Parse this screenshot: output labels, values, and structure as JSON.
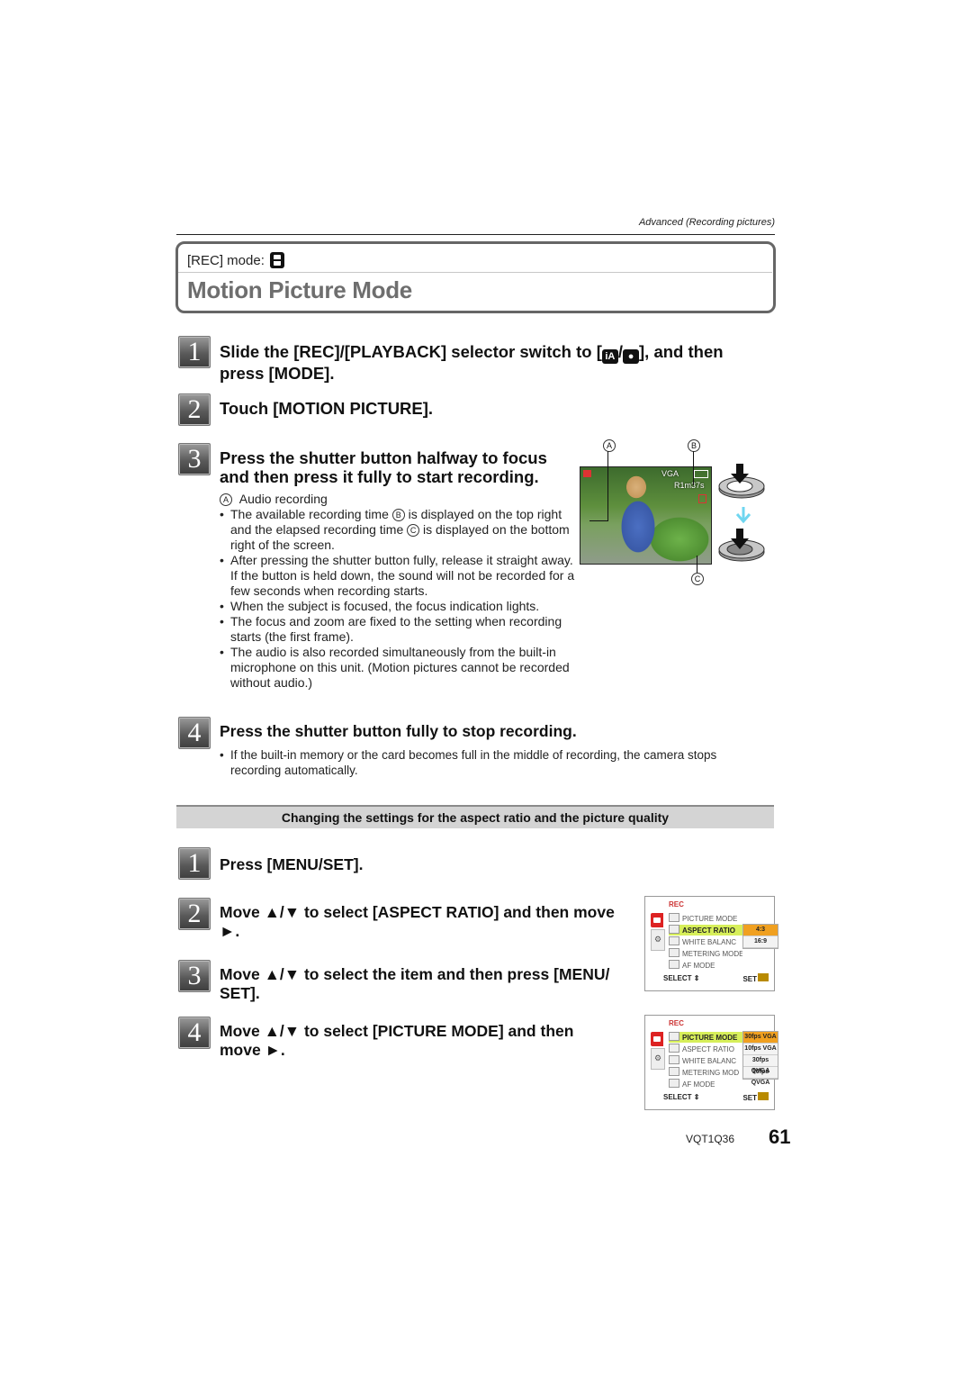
{
  "header": {
    "running_head": "Advanced (Recording pictures)"
  },
  "title_box": {
    "rec_mode_label": "[REC] mode:",
    "rec_mode_icon": "motion-picture-icon",
    "title": "Motion Picture Mode"
  },
  "steps": [
    {
      "number": "1",
      "text_before_icon": "Slide the [REC]/[PLAYBACK] selector switch to [",
      "icon_a": "iA",
      "icon_sep": "/",
      "icon_b": "camera-icon",
      "text_after_icon": "], and then press [MODE]."
    },
    {
      "number": "2",
      "text": "Touch [MOTION PICTURE]."
    },
    {
      "number": "3",
      "text": "Press the shutter button halfway to focus and then press it fully to start recording.",
      "callout_a_letter": "A",
      "callout_a_text": "Audio recording",
      "bullets": [
        {
          "before_b": "The available recording time ",
          "b": "B",
          "mid": " is displayed on the top right and the elapsed recording time ",
          "c": "C",
          "after": " is displayed on the bottom right of the screen."
        },
        {
          "text": "After pressing the shutter button fully, release it straight away. If the button is held down, the sound will not be recorded for a few seconds when recording starts."
        },
        {
          "text": "When the subject is focused, the focus indication lights."
        },
        {
          "text": "The focus and zoom are fixed to the setting when recording starts (the first frame)."
        },
        {
          "text": "The audio is also recorded simultaneously from the built-in microphone on this unit. (Motion pictures cannot be recorded without audio.)"
        }
      ]
    },
    {
      "number": "4",
      "text": "Press the shutter button fully to stop recording.",
      "bullets": [
        "If the built-in memory or the card becomes full in the middle of recording, the camera stops recording automatically."
      ]
    }
  ],
  "figure": {
    "callouts": [
      "A",
      "B",
      "C"
    ],
    "osd_remaining_time": "R1m37s",
    "osd_quality": "VGA",
    "shutter_icon": "shutter-button-icon",
    "arrow_color": "#6fd6f0"
  },
  "settings_section": {
    "heading": "Changing the settings for the aspect ratio and the picture quality",
    "steps": [
      {
        "number": "1",
        "text": "Press [MENU/SET]."
      },
      {
        "number": "2",
        "text": "Move ▲/▼ to select [ASPECT RATIO] and then move ►."
      },
      {
        "number": "3",
        "text": "Move ▲/▼ to select the item and then press [MENU/ SET]."
      },
      {
        "number": "4",
        "text": "Move ▲/▼ to select [PICTURE MODE] and then move ►."
      }
    ],
    "menu_screens": [
      {
        "header": "REC",
        "items": [
          "PICTURE MODE",
          "ASPECT RATIO",
          "WHITE BALANC",
          "METERING MODE",
          "AF MODE"
        ],
        "selected_index": 1,
        "popup_options": [
          "4:3",
          "16:9"
        ],
        "popup_selected": 0,
        "footer_select": "SELECT",
        "footer_set": "SET"
      },
      {
        "header": "REC",
        "items": [
          "PICTURE MODE",
          "ASPECT RATIO",
          "WHITE BALANC",
          "METERING MOD",
          "AF MODE"
        ],
        "selected_index": 0,
        "popup_options": [
          "30fps VGA",
          "10fps VGA",
          "30fps QVGA",
          "10fps QVGA"
        ],
        "popup_selected": 0,
        "footer_select": "SELECT",
        "footer_set": "SET"
      }
    ]
  },
  "footer": {
    "doc_code": "VQT1Q36",
    "page_number": "61"
  }
}
